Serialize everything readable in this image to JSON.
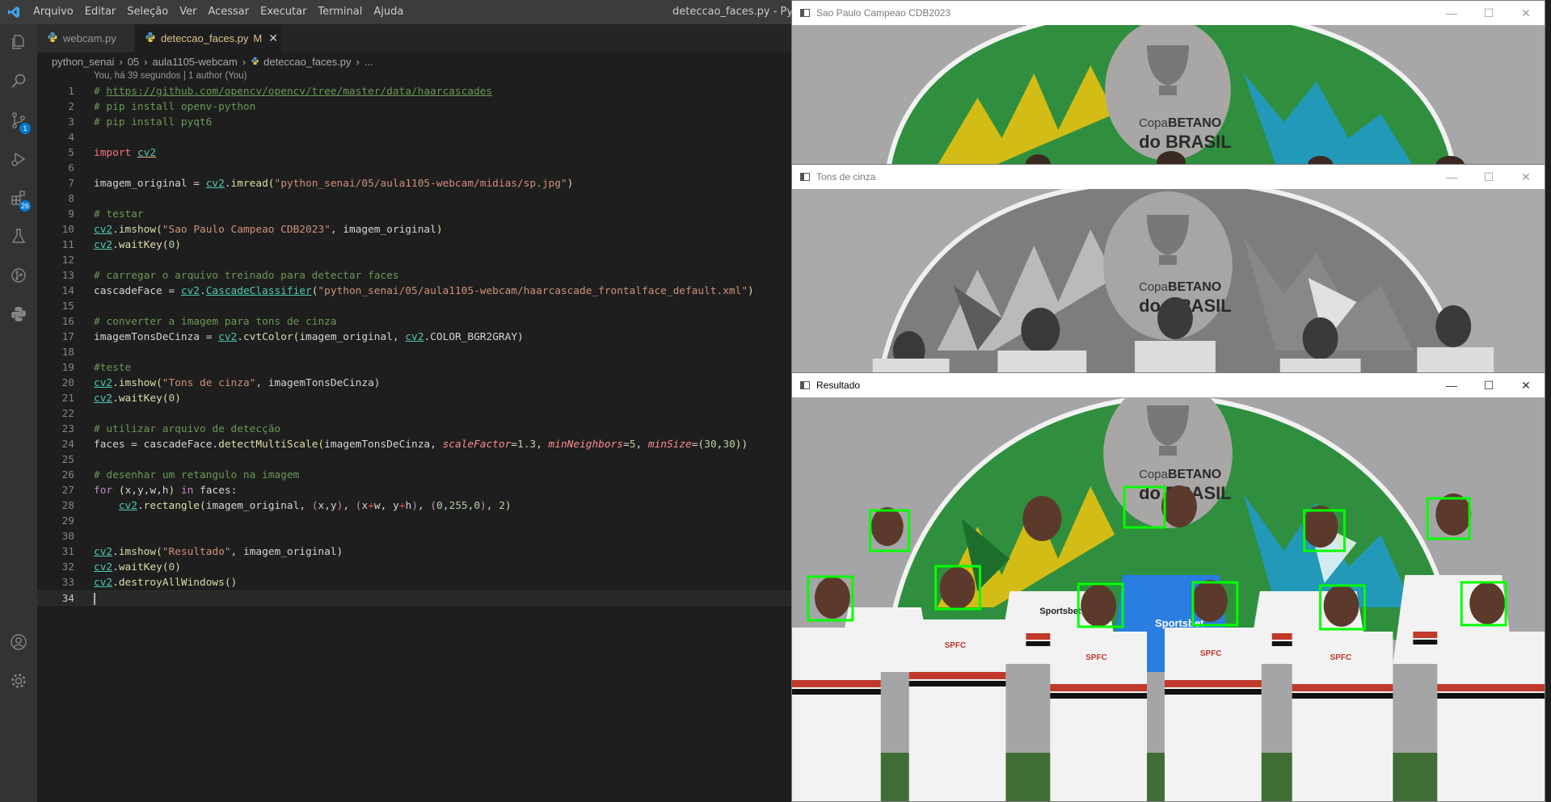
{
  "titlebar": {
    "menu": [
      "Arquivo",
      "Editar",
      "Seleção",
      "Ver",
      "Acessar",
      "Executar",
      "Terminal",
      "Ajuda"
    ],
    "window_title": "deteccao_faces.py - Python"
  },
  "activity": {
    "scm_badge": "1",
    "extensions_badge": "26"
  },
  "tabs": [
    {
      "label": "webcam.py",
      "modified": ""
    },
    {
      "label": "deteccao_faces.py",
      "modified": "M"
    }
  ],
  "breadcrumb": [
    "python_senai",
    "05",
    "aula1105-webcam",
    "deteccao_faces.py",
    "..."
  ],
  "blame": "You, há 39 segundos | 1 author (You)",
  "code_line_numbers": [
    "1",
    "2",
    "3",
    "4",
    "5",
    "6",
    "7",
    "8",
    "9",
    "10",
    "11",
    "12",
    "13",
    "14",
    "15",
    "16",
    "17",
    "18",
    "19",
    "20",
    "21",
    "22",
    "23",
    "24",
    "25",
    "26",
    "27",
    "28",
    "29",
    "30",
    "31",
    "32",
    "33",
    "34"
  ],
  "code": {
    "l1_hash": "# ",
    "l1_url": "https://github.com/opencv/opencv/tree/master/data/haarcascades",
    "l2": "# pip install openv-python",
    "l3": "# pip install pyqt6",
    "l5_import": "import",
    "l5_mod": "cv2",
    "l7_var": "imagem_original",
    "l7_eq": " = ",
    "l7_mod": "cv2",
    "l7_func": "imread",
    "l7_str": "\"python_senai/05/aula1105-webcam/midias/sp.jpg\"",
    "l9": "# testar",
    "l10_mod": "cv2",
    "l10_func": "imshow",
    "l10_str": "\"Sao Paulo Campeao CDB2023\"",
    "l10_arg": "imagem_original",
    "l11_mod": "cv2",
    "l11_func": "waitKey",
    "l11_num": "0",
    "l13": "# carregar o arquivo treinado para detectar faces",
    "l14_var": "cascadeFace",
    "l14_mod": "cv2",
    "l14_cls": "CascadeClassifier",
    "l14_str": "\"python_senai/05/aula1105-webcam/haarcascade_frontalface_default.xml\"",
    "l16": "# converter a imagem para tons de cinza",
    "l17_var": "imagemTonsDeCinza",
    "l17_mod": "cv2",
    "l17_func": "cvtColor",
    "l17_arg": "imagem_original",
    "l17_mod2": "cv2",
    "l17_const": "COLOR_BGR2GRAY",
    "l19": "#teste",
    "l20_mod": "cv2",
    "l20_func": "imshow",
    "l20_str": "\"Tons de cinza\"",
    "l20_arg": "imagemTonsDeCinza",
    "l21_mod": "cv2",
    "l21_func": "waitKey",
    "l21_num": "0",
    "l23": "# utilizar arquivo de detecção",
    "l24_var": "faces",
    "l24_obj": "cascadeFace",
    "l24_func": "detectMultiScale",
    "l24_arg": "imagemTonsDeCinza",
    "l24_kw1": "scaleFactor",
    "l24_n1": "1.3",
    "l24_kw2": "minNeighbors",
    "l24_n2": "5",
    "l24_kw3": "minSize",
    "l24_n3a": "30",
    "l24_n3b": "30",
    "l26": "# desenhar um retangulo na imagem",
    "l27_for": "for",
    "l27_vars": "x,y,w,h",
    "l27_in": "in",
    "l27_iter": "faces",
    "l28_mod": "cv2",
    "l28_func": "rectangle",
    "l28_arg": "imagem_original",
    "l28_x": "x",
    "l28_y": "y",
    "l28_w": "w",
    "l28_h": "h",
    "l28_c0": "0",
    "l28_c1": "255",
    "l28_c2": "0",
    "l28_t": "2",
    "l31_mod": "cv2",
    "l31_func": "imshow",
    "l31_str": "\"Resultado\"",
    "l31_arg": "imagem_original",
    "l32_mod": "cv2",
    "l32_func": "waitKey",
    "l32_num": "0",
    "l33_mod": "cv2",
    "l33_func": "destroyAllWindows"
  },
  "windows": {
    "original": {
      "title": "Sao Paulo Campeao CDB2023"
    },
    "gray": {
      "title": "Tons de cinza"
    },
    "result": {
      "title": "Resultado"
    }
  },
  "photo_text": {
    "brand_line1": "Copa",
    "brand_bold": "BETANO",
    "brand_line2": "do BRASIL",
    "sponsor": "Sportsbet",
    "crest": "SPFC"
  },
  "colors": {
    "editor_bg": "#1e1e1e",
    "activity_bg": "#333333",
    "badge": "#0078d4",
    "face_box": "#00ff00"
  }
}
